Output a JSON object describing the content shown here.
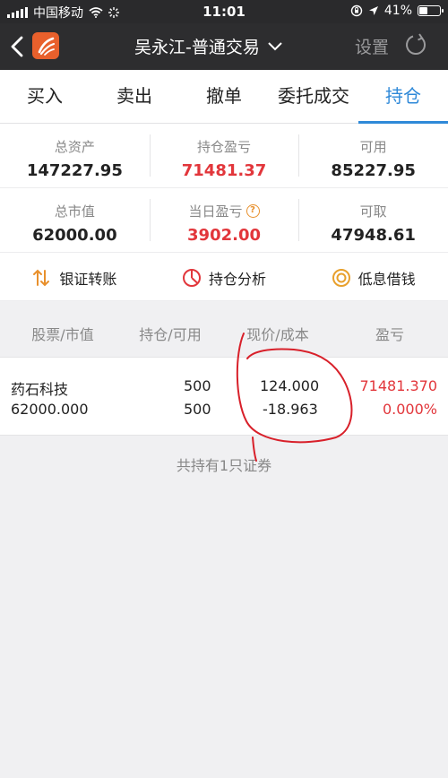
{
  "status_bar": {
    "carrier": "中国移动",
    "time": "11:01",
    "battery": "41%",
    "battery_level": 0.41
  },
  "nav": {
    "title": "吴永江-普通交易",
    "settings_label": "设置"
  },
  "tabs": [
    {
      "label": "买入",
      "active": false
    },
    {
      "label": "卖出",
      "active": false
    },
    {
      "label": "撤单",
      "active": false
    },
    {
      "label": "委托成交",
      "active": false
    },
    {
      "label": "持仓",
      "active": true
    }
  ],
  "summary": {
    "total_assets": {
      "label": "总资产",
      "value": "147227.95"
    },
    "position_pl": {
      "label": "持仓盈亏",
      "value": "71481.37"
    },
    "available": {
      "label": "可用",
      "value": "85227.95"
    },
    "market_value": {
      "label": "总市值",
      "value": "62000.00"
    },
    "daily_pl": {
      "label": "当日盈亏",
      "value": "3902.00"
    },
    "withdrawable": {
      "label": "可取",
      "value": "47948.61"
    }
  },
  "actions": [
    {
      "label": "银证转账",
      "icon": "transfer-icon"
    },
    {
      "label": "持仓分析",
      "icon": "pie-chart-icon"
    },
    {
      "label": "低息借钱",
      "icon": "coin-icon"
    }
  ],
  "holdings": {
    "headers": [
      "股票/市值",
      "持仓/可用",
      "现价/成本",
      "盈亏"
    ],
    "rows": [
      {
        "name": "药石科技",
        "market_value": "62000.000",
        "position": "500",
        "available": "500",
        "price": "124.000",
        "cost": "-18.963",
        "pl": "71481.370",
        "pl_pct": "0.000%"
      }
    ],
    "summary": "共持有1只证券"
  },
  "colors": {
    "accent": "#2f89d8",
    "red": "#e2363b",
    "nav_bg": "#2d2d2f",
    "annotation": "#d8202a"
  }
}
